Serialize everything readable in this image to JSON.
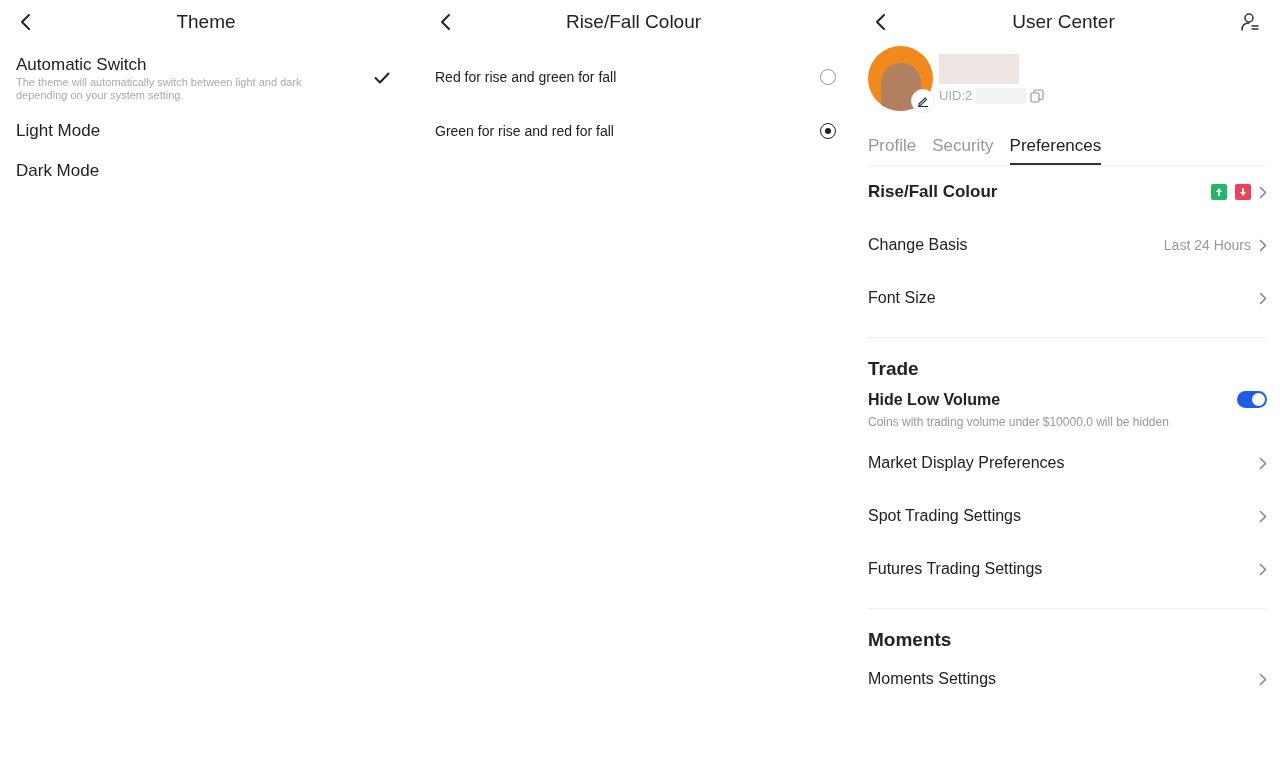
{
  "theme_panel": {
    "title": "Theme",
    "options": [
      {
        "label": "Automatic Switch",
        "description": "The theme will automatically switch between light and dark depending on your system setting.",
        "selected": true
      },
      {
        "label": "Light Mode",
        "selected": false
      },
      {
        "label": "Dark Mode",
        "selected": false
      }
    ]
  },
  "colour_panel": {
    "title": "Rise/Fall Colour",
    "options": [
      {
        "label": "Red for rise and green for fall",
        "selected": false
      },
      {
        "label": "Green for rise and red for fall",
        "selected": true
      }
    ]
  },
  "user_center": {
    "title": "User Center",
    "uid_label": "UID:2",
    "tabs": [
      {
        "label": "Profile",
        "selected": false
      },
      {
        "label": "Security",
        "selected": false
      },
      {
        "label": "Preferences",
        "selected": true
      }
    ],
    "sections": [
      {
        "items": [
          {
            "kind": "colour",
            "label": "Rise/Fall Colour"
          },
          {
            "kind": "link",
            "label": "Change Basis",
            "value": "Last 24 Hours"
          },
          {
            "kind": "link",
            "label": "Font Size"
          }
        ]
      },
      {
        "header": "Trade",
        "items": [
          {
            "kind": "toggle",
            "label": "Hide Low Volume",
            "description": "Coins with trading volume under $10000.0 will be hidden",
            "on": true
          },
          {
            "kind": "link",
            "label": "Market Display Preferences"
          },
          {
            "kind": "link",
            "label": "Spot Trading Settings"
          },
          {
            "kind": "link",
            "label": "Futures Trading Settings"
          }
        ]
      },
      {
        "header": "Moments",
        "items": [
          {
            "kind": "link",
            "label": "Moments Settings"
          }
        ]
      }
    ]
  }
}
